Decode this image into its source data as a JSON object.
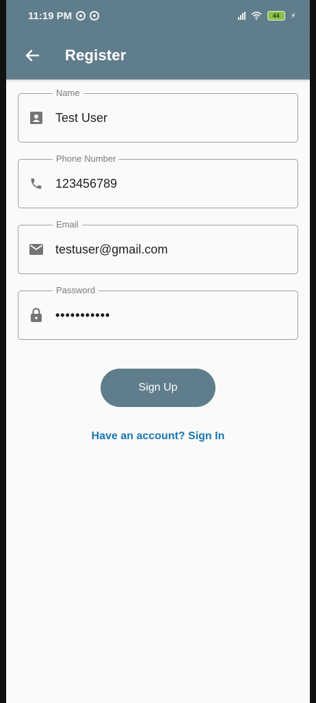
{
  "status_bar": {
    "time": "11:19 PM",
    "battery": "44"
  },
  "app_bar": {
    "title": "Register"
  },
  "form": {
    "name": {
      "label": "Name",
      "value": "Test User"
    },
    "phone": {
      "label": "Phone Number",
      "value": "123456789"
    },
    "email": {
      "label": "Email",
      "value": "testuser@gmail.com"
    },
    "password": {
      "label": "Password",
      "value": "•••••••••••"
    }
  },
  "actions": {
    "signup_label": "Sign Up",
    "signin_link": "Have an account? Sign In"
  },
  "colors": {
    "primary": "#607d8b",
    "link": "#1976b0",
    "icon": "#757575"
  },
  "icons": {
    "back": "arrow-left-icon",
    "name": "account-box-icon",
    "phone": "phone-icon",
    "email": "mail-icon",
    "password": "lock-icon"
  }
}
